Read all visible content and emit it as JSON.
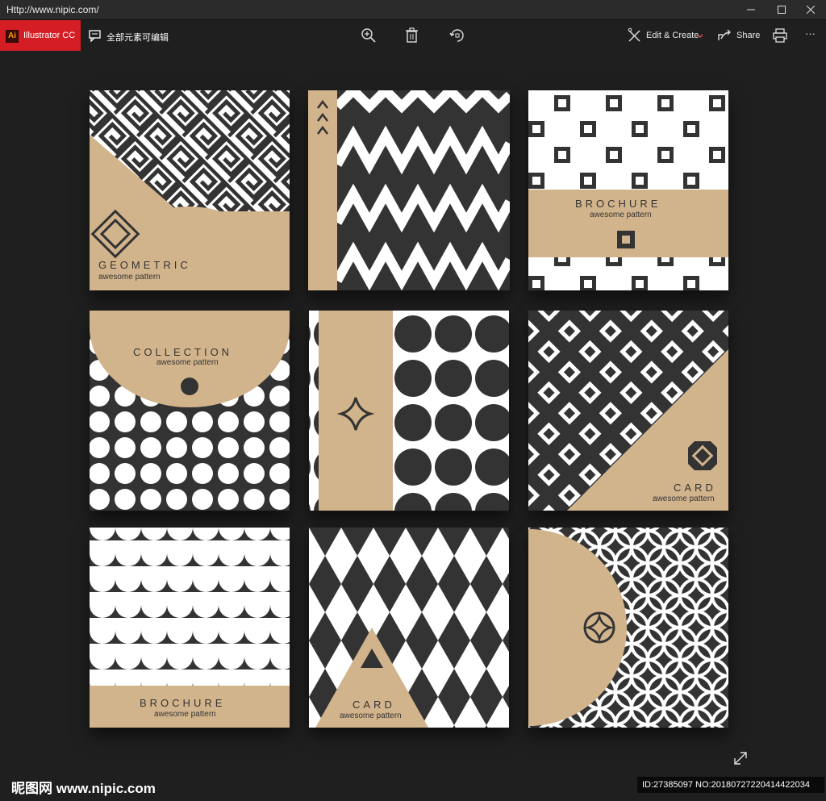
{
  "window": {
    "title": "Http://www.nipic.com/"
  },
  "toolbar": {
    "app_badge_icon_text": "Ai",
    "app_badge_label": "Illustrator CC",
    "editable_note": "全部元素可编辑",
    "edit_create_label": "Edit & Create",
    "share_label": "Share",
    "more_label": "···"
  },
  "tiles": {
    "geometric_title": "GEOMETRIC",
    "geometric_sub": "awesome pattern",
    "collection_title": "COLLECTION",
    "collection_sub": "awesome pattern",
    "brochure_top_title": "BROCHURE",
    "brochure_top_sub": "awesome pattern",
    "card_right_title": "CARD",
    "card_right_sub": "awesome pattern",
    "brochure_bottom_title": "BROCHURE",
    "brochure_bottom_sub": "awesome pattern",
    "card_bottom_title": "CARD",
    "card_bottom_sub": "awesome pattern"
  },
  "watermark": {
    "left": "昵图网 www.nipic.com",
    "right": "ID:27385097 NO:20180727220414422034"
  },
  "colors": {
    "kraft": "#d2b48c",
    "dark": "#333333",
    "light": "#ffffff",
    "accent_red": "#d51e24"
  }
}
